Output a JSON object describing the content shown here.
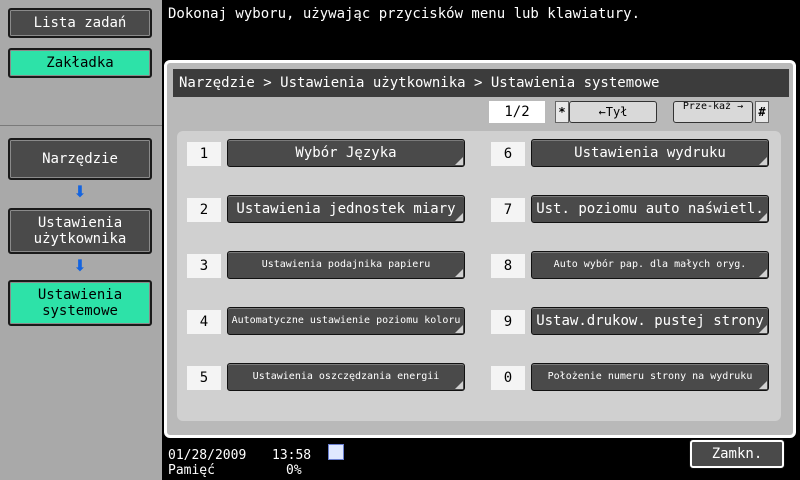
{
  "sidebar": {
    "job_list": "Lista zadań",
    "bookmark": "Zakładka",
    "steps": [
      "Narzędzie",
      "Ustawienia użytkownika",
      "Ustawienia systemowe"
    ]
  },
  "message": "Dokonaj wyboru, używając przycisków menu lub klawiatury.",
  "breadcrumb": "Narzędzie > Ustawienia użytkownika  > Ustawienia systemowe",
  "pager": {
    "page": "1/2",
    "back_key": "*",
    "back_label": "←Tył",
    "forward_label": "Prze-każ →",
    "forward_key": "#"
  },
  "items": [
    {
      "num": "1",
      "label": "Wybór Języka"
    },
    {
      "num": "2",
      "label": "Ustawienia jednostek miary"
    },
    {
      "num": "3",
      "label": "Ustawienia podajnika papieru"
    },
    {
      "num": "4",
      "label": "Automatyczne ustawienie poziomu koloru"
    },
    {
      "num": "5",
      "label": "Ustawienia oszczędzania energii"
    },
    {
      "num": "6",
      "label": "Ustawienia wydruku"
    },
    {
      "num": "7",
      "label": "Ust. poziomu auto naświetl."
    },
    {
      "num": "8",
      "label": "Auto wybór pap. dla małych oryg."
    },
    {
      "num": "9",
      "label": "Ustaw.drukow. pustej strony"
    },
    {
      "num": "0",
      "label": "Położenie numeru strony na wydruku"
    }
  ],
  "status": {
    "date": "01/28/2009",
    "time": "13:58",
    "memory_label": "Pamięć",
    "memory_value": "0%"
  },
  "close_label": "Zamkn.",
  "colors": {
    "accent": "#2de2a8",
    "dark_button": "#4a4a4a",
    "arrow": "#1464e0"
  }
}
